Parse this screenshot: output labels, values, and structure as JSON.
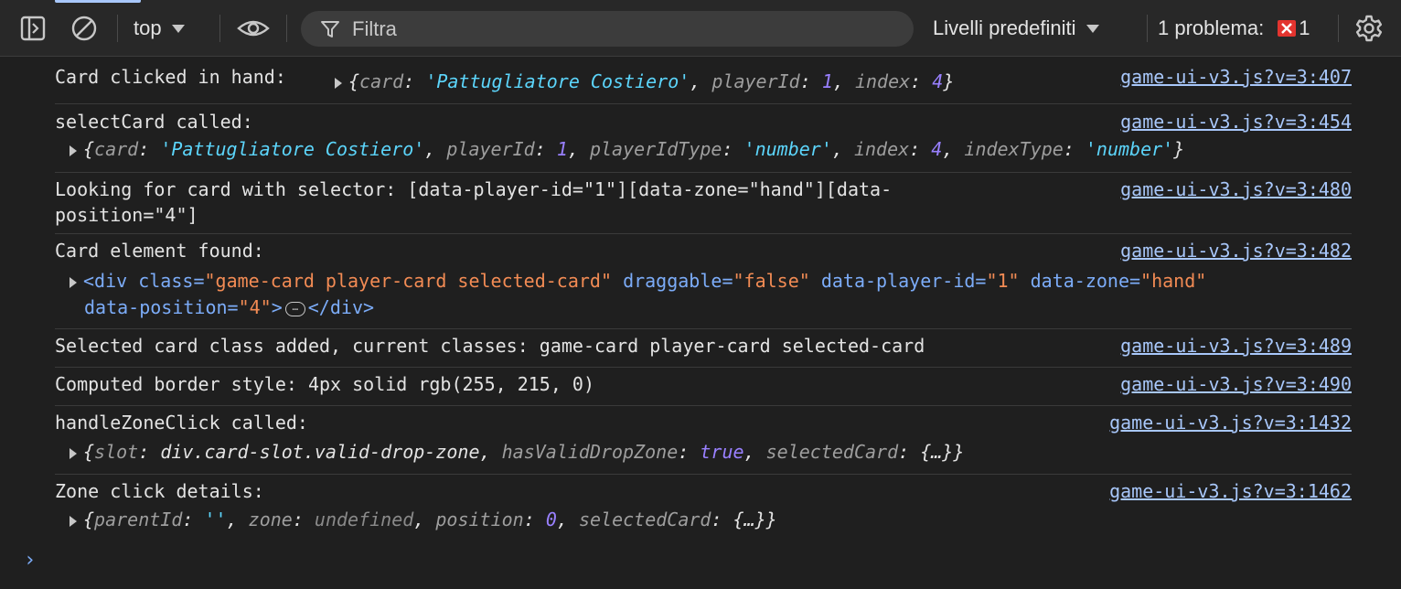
{
  "toolbar": {
    "context_label": "top",
    "filter_placeholder": "Filtra",
    "levels_label": "Livelli predefiniti",
    "issues_label": "1 problema:",
    "issues_count": "1"
  },
  "messages": [
    {
      "text": "Card clicked in hand:",
      "source": "game-ui-v3.js?v=3:407",
      "object": {
        "card_key": "card",
        "card_val": "'Pattugliatore Costiero'",
        "pid_key": "playerId",
        "pid_val": "1",
        "idx_key": "index",
        "idx_val": "4"
      }
    },
    {
      "text": "selectCard called:",
      "source": "game-ui-v3.js?v=3:454",
      "object": {
        "card_key": "card",
        "card_val": "'Pattugliatore Costiero'",
        "pid_key": "playerId",
        "pid_val": "1",
        "pidt_key": "playerIdType",
        "pidt_val": "'number'",
        "idx_key": "index",
        "idx_val": "4",
        "idxt_key": "indexType",
        "idxt_val": "'number'"
      }
    },
    {
      "text_line1": "Looking for card with selector: [data-player-id=\"1\"][data-zone=\"hand\"][data-",
      "text_line2": "position=\"4\"]",
      "source": "game-ui-v3.js?v=3:480"
    },
    {
      "text": "Card element found:",
      "source": "game-ui-v3.js?v=3:482",
      "element": {
        "tag": "div",
        "class_attr": "class",
        "class_val": "\"game-card player-card selected-card\"",
        "draggable_attr": "draggable",
        "draggable_val": "\"false\"",
        "pid_attr": "data-player-id",
        "pid_val": "\"1\"",
        "zone_attr": "data-zone",
        "zone_val": "\"hand\"",
        "pos_attr": "data-position",
        "pos_val": "\"4\"",
        "ellipsis": "…"
      }
    },
    {
      "text": "Selected card class added, current classes: game-card player-card selected-card",
      "source": "game-ui-v3.js?v=3:489"
    },
    {
      "text": "Computed border style: 4px solid rgb(255, 215, 0)",
      "source": "game-ui-v3.js?v=3:490"
    },
    {
      "text": "handleZoneClick called:",
      "source": "game-ui-v3.js?v=3:1432",
      "object": {
        "slot_key": "slot",
        "slot_val": "div.card-slot.valid-drop-zone",
        "hv_key": "hasValidDropZone",
        "hv_val": "true",
        "sc_key": "selectedCard",
        "sc_val": "{…}"
      }
    },
    {
      "text": "Zone click details:",
      "source": "game-ui-v3.js?v=3:1462",
      "object": {
        "pid_key": "parentId",
        "pid_val": "''",
        "zone_key": "zone",
        "zone_val": "undefined",
        "pos_key": "position",
        "pos_val": "0",
        "sc_key": "selectedCard",
        "sc_val": "{…}"
      }
    }
  ],
  "prompt_symbol": "›",
  "colors": {
    "background": "#1f1f1f",
    "link": "#a8c7fa",
    "string": "#5cd5fb",
    "number": "#9980ff",
    "attr_value": "#f28b54",
    "error_badge": "#e3342f"
  },
  "icons": [
    "sidebar-toggle-icon",
    "clear-console-icon",
    "chevron-down-icon",
    "eye-icon",
    "filter-icon",
    "error-icon",
    "gear-icon"
  ]
}
